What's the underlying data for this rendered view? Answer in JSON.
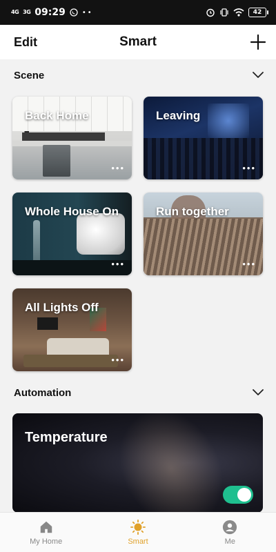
{
  "status_bar": {
    "signal_1": "4G",
    "signal_2": "3G",
    "time": "09:29",
    "battery": "42"
  },
  "header": {
    "edit_label": "Edit",
    "title": "Smart",
    "add_icon": "plus-icon"
  },
  "scene_section": {
    "label": "Scene",
    "collapse_icon": "chevron-down-icon",
    "cards": [
      {
        "title": "Back Home",
        "more": "•••"
      },
      {
        "title": "Leaving",
        "more": "•••"
      },
      {
        "title": "Whole House On",
        "more": "•••"
      },
      {
        "title": "Run together",
        "more": "•••"
      },
      {
        "title": "All Lights Off",
        "more": "•••"
      }
    ]
  },
  "automation_section": {
    "label": "Automation",
    "collapse_icon": "chevron-down-icon",
    "cards": [
      {
        "title": "Temperature",
        "enabled": true
      }
    ]
  },
  "bottom_nav": {
    "items": [
      {
        "label": "My Home",
        "icon": "home-icon",
        "active": false
      },
      {
        "label": "Smart",
        "icon": "sun-icon",
        "active": true
      },
      {
        "label": "Me",
        "icon": "user-icon",
        "active": false
      }
    ]
  },
  "colors": {
    "accent": "#e0a12a",
    "toggle_on": "#1fbf8f"
  }
}
